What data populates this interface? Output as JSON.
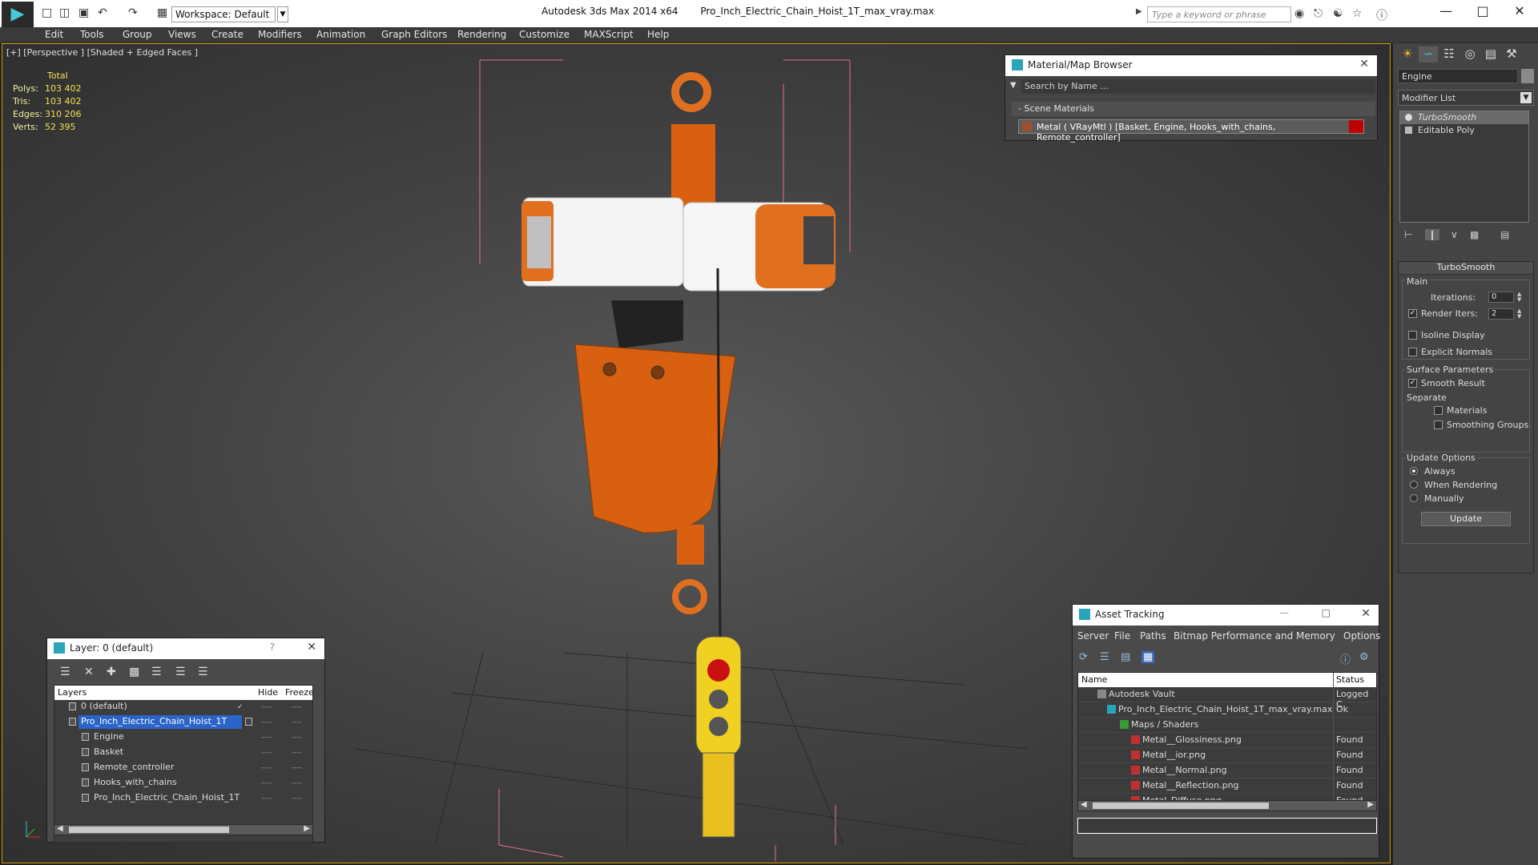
{
  "app": {
    "name": "Autodesk 3ds Max  2014 x64",
    "file": "Pro_Inch_Electric_Chain_Hoist_1T_max_vray.max",
    "workspace": "Workspace: Default",
    "search_placeholder": "Type a keyword or phrase"
  },
  "menu": [
    "Edit",
    "Tools",
    "Group",
    "Views",
    "Create",
    "Modifiers",
    "Animation",
    "Graph Editors",
    "Rendering",
    "Customize",
    "MAXScript",
    "Help"
  ],
  "viewport": {
    "label": "[+] [Perspective ] [Shaded + Edged Faces ]",
    "stats": {
      "header": "Total",
      "polys_label": "Polys:",
      "polys": "103 402",
      "tris_label": "Tris:",
      "tris": "103 402",
      "edges_label": "Edges:",
      "edges": "310 206",
      "verts_label": "Verts:",
      "verts": "52 395"
    }
  },
  "material_browser": {
    "title": "Material/Map Browser",
    "search": "Search by Name ...",
    "group": "- Scene Materials",
    "item": "Metal  ( VRayMtl ) [Basket, Engine, Hooks_with_chains, Remote_controller]",
    "swatch_color": "#c00000"
  },
  "layer_panel": {
    "title": "Layer: 0 (default)",
    "help": "?",
    "col_layers": "Layers",
    "col_hide": "Hide",
    "col_freeze": "Freeze",
    "rows": [
      "0 (default)",
      "Pro_Inch_Electric_Chain_Hoist_1T",
      "Engine",
      "Basket",
      "Remote_controller",
      "Hooks_with_chains",
      "Pro_Inch_Electric_Chain_Hoist_1T"
    ],
    "dash": "----"
  },
  "asset_tracking": {
    "title": "Asset Tracking",
    "menu": [
      "Server",
      "File",
      "Paths",
      "Bitmap Performance and Memory",
      "Options"
    ],
    "col_name": "Name",
    "col_status": "Status",
    "rows": [
      {
        "name": "Autodesk Vault",
        "status": "Logged C"
      },
      {
        "name": "Pro_Inch_Electric_Chain_Hoist_1T_max_vray.max",
        "status": "Ok"
      },
      {
        "name": "Maps / Shaders",
        "status": ""
      },
      {
        "name": "Metal__Glossiness.png",
        "status": "Found"
      },
      {
        "name": "Metal__ior.png",
        "status": "Found"
      },
      {
        "name": "Metal__Normal.png",
        "status": "Found"
      },
      {
        "name": "Metal__Reflection.png",
        "status": "Found"
      },
      {
        "name": "Metal_Diffuse.png",
        "status": "Found"
      }
    ]
  },
  "command_panel": {
    "object_name": "Engine",
    "modifier_list": "Modifier List",
    "stack": [
      "TurboSmooth",
      "Editable Poly"
    ],
    "rollout_title": "TurboSmooth",
    "main_label": "Main",
    "iterations_label": "Iterations:",
    "iterations": "0",
    "render_iters_label": "Render Iters:",
    "render_iters": "2",
    "isoline": "Isoline Display",
    "explicit": "Explicit Normals",
    "surface_params": "Surface Parameters",
    "smooth_result": "Smooth Result",
    "separate": "Separate",
    "materials": "Materials",
    "smoothing_groups": "Smoothing Groups",
    "update_options": "Update Options",
    "always": "Always",
    "when_rendering": "When Rendering",
    "manually": "Manually",
    "update_btn": "Update"
  }
}
